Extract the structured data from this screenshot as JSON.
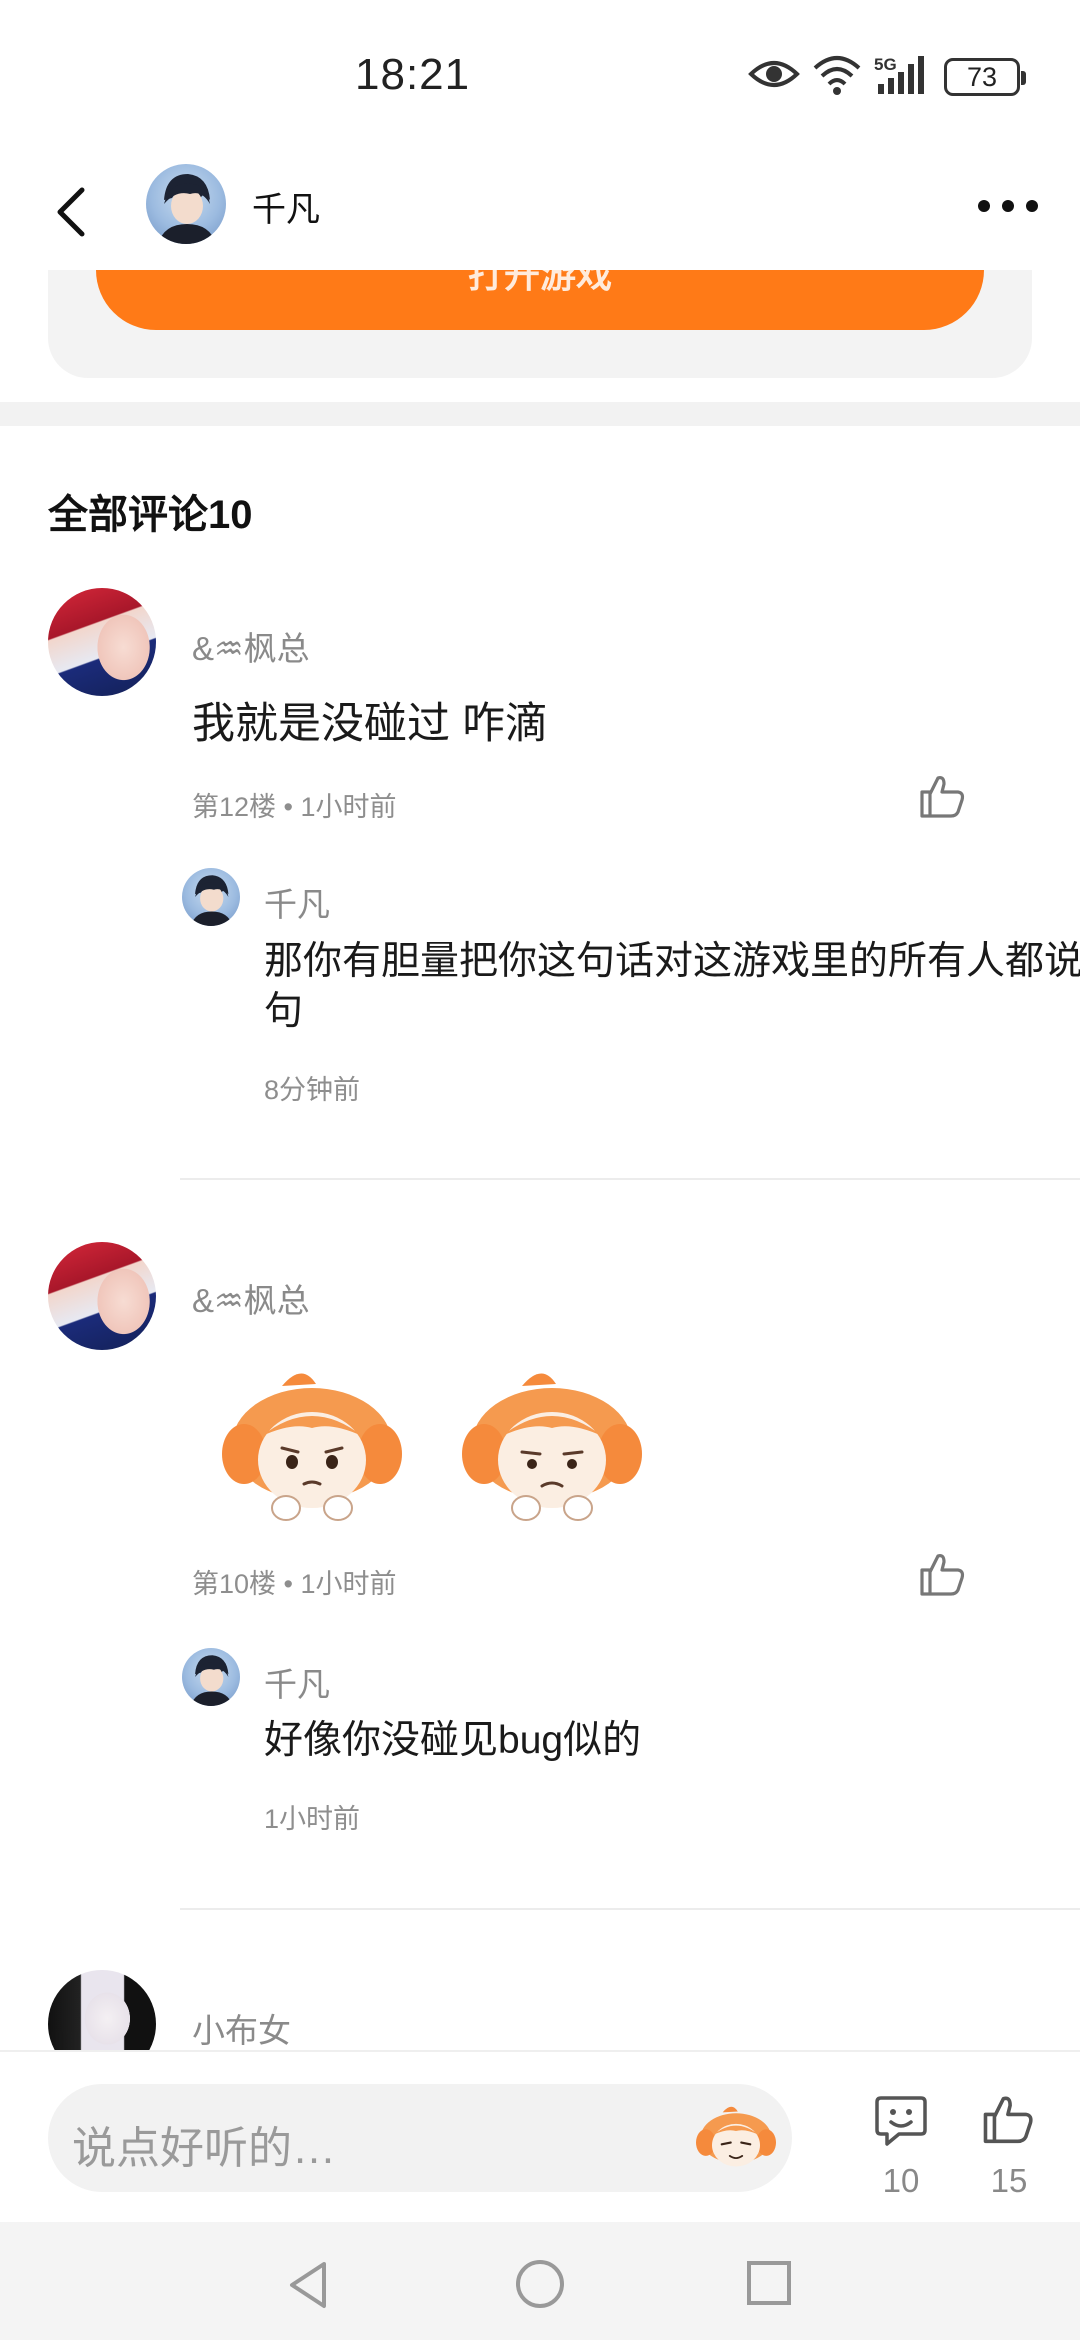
{
  "status_bar": {
    "time": "18:21",
    "battery": "73",
    "network": "5G"
  },
  "header": {
    "user_name": "千凡"
  },
  "top_card": {
    "button_label": "打开游戏"
  },
  "comments_section": {
    "title": "全部评论10"
  },
  "comments": [
    {
      "user": "&♒枫总",
      "text": "我就是没碰过 咋滴",
      "meta": "第12楼 • 1小时前",
      "reply": {
        "user": "千凡",
        "text": "那你有胆量把你这句话对这游戏里的所有人都说一句",
        "time": "8分钟前"
      }
    },
    {
      "user": "&♒枫总",
      "text": "",
      "meta": "第10楼 • 1小时前",
      "reply": {
        "user": "千凡",
        "text": "好像你没碰见bug似的",
        "time": "1小时前"
      }
    },
    {
      "user": "小布女"
    }
  ],
  "bottom_bar": {
    "input_placeholder": "说点好听的…",
    "comment_count": "10",
    "like_count": "15"
  },
  "colors": {
    "accent": "#ff7a17",
    "text_secondary": "#8a8a8a"
  }
}
